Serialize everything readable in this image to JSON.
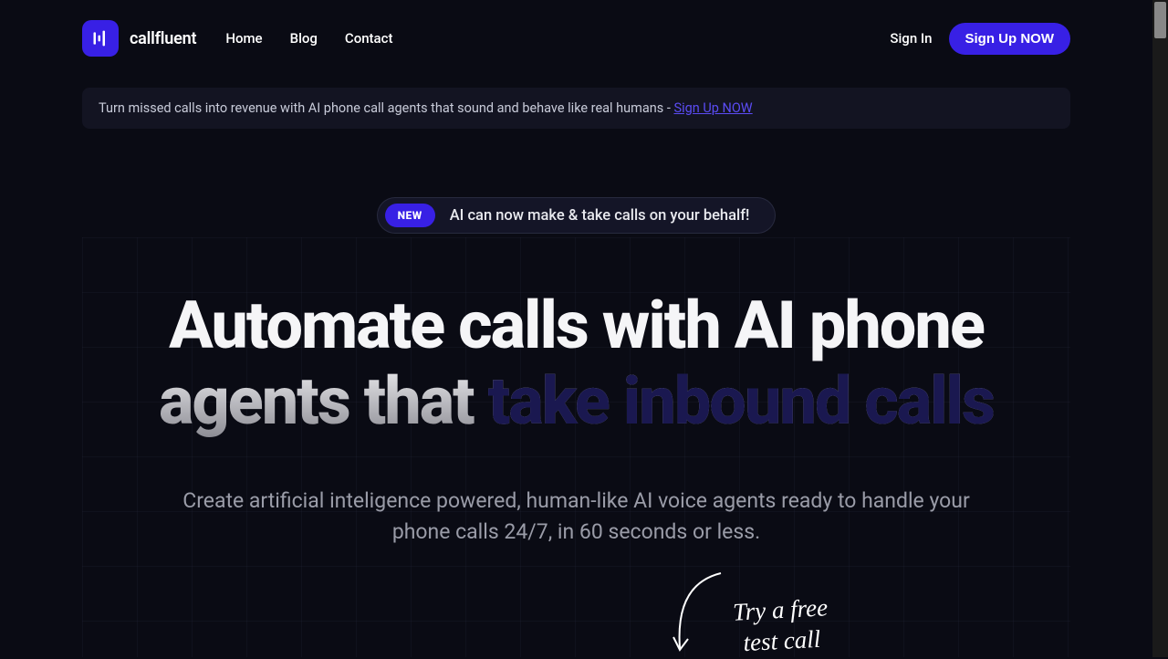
{
  "brand": {
    "name": "callfluent"
  },
  "nav": {
    "items": [
      "Home",
      "Blog",
      "Contact"
    ]
  },
  "header": {
    "signin": "Sign In",
    "signup": "Sign Up NOW"
  },
  "banner": {
    "text": "Turn missed calls into revenue with AI phone call agents that sound and behave like real humans - ",
    "link": "Sign Up NOW"
  },
  "pill": {
    "badge": "NEW",
    "text": "AI can now make & take calls on your behalf!"
  },
  "hero": {
    "headline_prefix": "Automate calls with AI phone agents that ",
    "headline_accent": "take inbound calls",
    "subhead": "Create artificial inteligence powered, human-like AI voice agents ready to handle your phone calls 24/7, in 60 seconds or less."
  },
  "callout": {
    "line1": "Try a free",
    "line2": "test call"
  }
}
